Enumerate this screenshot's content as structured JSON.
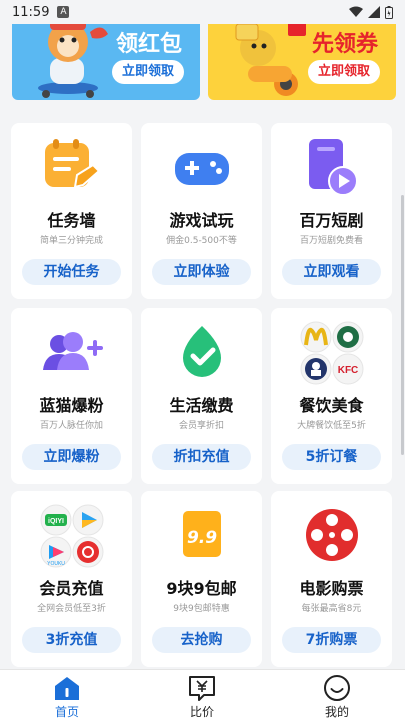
{
  "status_bar": {
    "time": "11:59",
    "badge": "A"
  },
  "banners": [
    {
      "title": "领红包",
      "button": "立即领取",
      "bg": "#5ab8f2"
    },
    {
      "title": "先领券",
      "button": "立即领取",
      "bg": "#fdd23c"
    }
  ],
  "cards": [
    {
      "title": "任务墙",
      "subtitle": "简单三分钟完成",
      "button": "开始任务",
      "icon": "task-note-icon"
    },
    {
      "title": "游戏试玩",
      "subtitle": "佣金0.5-500不等",
      "button": "立即体验",
      "icon": "gamepad-icon"
    },
    {
      "title": "百万短剧",
      "subtitle": "百万短剧免费看",
      "button": "立即观看",
      "icon": "video-play-icon"
    },
    {
      "title": "蓝猫爆粉",
      "subtitle": "百万人脉任你加",
      "button": "立即爆粉",
      "icon": "add-users-icon"
    },
    {
      "title": "生活缴费",
      "subtitle": "会员享折扣",
      "button": "折扣充值",
      "icon": "drop-check-icon"
    },
    {
      "title": "餐饮美食",
      "subtitle": "大牌餐饮低至5折",
      "button": "5折订餐",
      "icon": "restaurant-brands-icon"
    },
    {
      "title": "会员充值",
      "subtitle": "全网会员低至3折",
      "button": "3折充值",
      "icon": "video-apps-icon"
    },
    {
      "title": "9块9包邮",
      "subtitle": "9块9包邮特惠",
      "button": "去抢购",
      "icon": "price-tag-99-icon"
    },
    {
      "title": "电影购票",
      "subtitle": "每张最高省8元",
      "button": "7折购票",
      "icon": "film-reel-icon"
    }
  ],
  "brand_labels": {
    "kfc": "KFC",
    "iqiyi": "iQIYI",
    "youku": "YOUKU",
    "price": "9.9"
  },
  "tabbar": [
    {
      "label": "首页",
      "active": true,
      "icon": "home-icon"
    },
    {
      "label": "比价",
      "active": false,
      "icon": "yen-compare-icon"
    },
    {
      "label": "我的",
      "active": false,
      "icon": "profile-smile-icon"
    }
  ],
  "colors": {
    "accent": "#1b6fd8",
    "button_bg": "#e8f1fb",
    "red": "#e6242c",
    "yellow": "#fdd23c",
    "blue": "#5ab8f2"
  }
}
